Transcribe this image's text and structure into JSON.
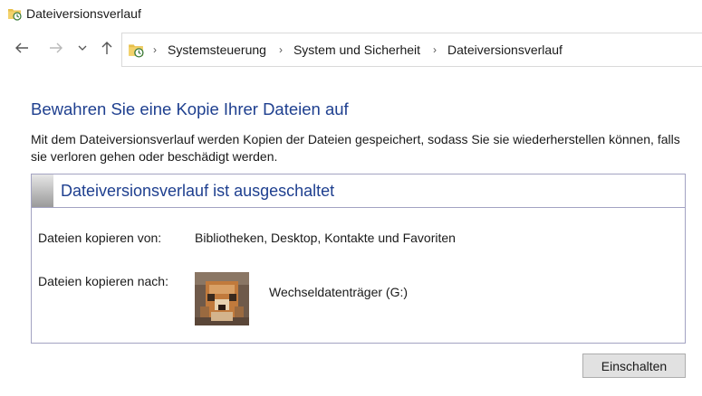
{
  "window": {
    "title": "Dateiversionsverlauf",
    "icon": "file-history-icon"
  },
  "nav": {
    "back_icon": "arrow-left-icon",
    "forward_icon": "arrow-right-icon",
    "recent_icon": "chevron-down-icon",
    "up_icon": "arrow-up-icon"
  },
  "breadcrumb": {
    "items": [
      "Systemsteuerung",
      "System und Sicherheit",
      "Dateiversionsverlauf"
    ]
  },
  "main": {
    "heading": "Bewahren Sie eine Kopie Ihrer Dateien auf",
    "description": "Mit dem Dateiversionsverlauf werden Kopien der Dateien gespeichert, sodass Sie sie wiederherstellen können, falls sie verloren gehen oder beschädigt werden."
  },
  "panel": {
    "status": "Dateiversionsverlauf ist ausgeschaltet",
    "copy_from_label": "Dateien kopieren von:",
    "copy_from_value": "Bibliotheken, Desktop, Kontakte und Favoriten",
    "copy_to_label": "Dateien kopieren nach:",
    "copy_to_value": "Wechseldatenträger (G:)"
  },
  "actions": {
    "enable_label": "Einschalten"
  },
  "colors": {
    "accent_heading": "#1e3f8f",
    "panel_border": "#a3a3c2",
    "button_bg": "#e1e1e1"
  }
}
